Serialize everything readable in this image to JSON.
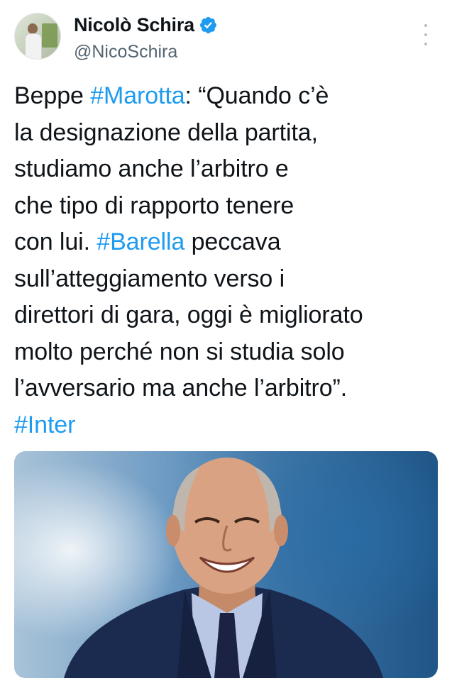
{
  "author": {
    "name": "Nicolò Schira",
    "handle": "@NicoSchira",
    "verified": true,
    "avatar_icon": "profile-photo",
    "verified_icon": "verified-badge-icon"
  },
  "tweet": {
    "lines": [
      [
        {
          "text": "Beppe "
        },
        {
          "text": "#Marotta",
          "tag": true
        },
        {
          "text": ": “Quando c’è"
        }
      ],
      [
        {
          "text": "la designazione della partita,"
        }
      ],
      [
        {
          "text": "studiamo anche l’arbitro e"
        }
      ],
      [
        {
          "text": "che tipo di rapporto tenere"
        }
      ],
      [
        {
          "text": "con lui. "
        },
        {
          "text": "#Barella",
          "tag": true
        },
        {
          "text": " peccava"
        }
      ],
      [
        {
          "text": "sull’atteggiamento verso i"
        }
      ],
      [
        {
          "text": "direttori di gara, oggi è migliorato"
        }
      ],
      [
        {
          "text": "molto perché non si studia solo"
        }
      ],
      [
        {
          "text": "l’avversario ma anche l’arbitro”."
        }
      ],
      [
        {
          "text": "#Inter",
          "tag": true
        }
      ]
    ]
  },
  "media": {
    "kind": "photo",
    "subject": "smiling-bald-man-in-suit"
  },
  "colors": {
    "hashtag": "#1d9bf0",
    "handle": "#536471",
    "text": "#0f1419",
    "verified": "#1d9bf0"
  }
}
